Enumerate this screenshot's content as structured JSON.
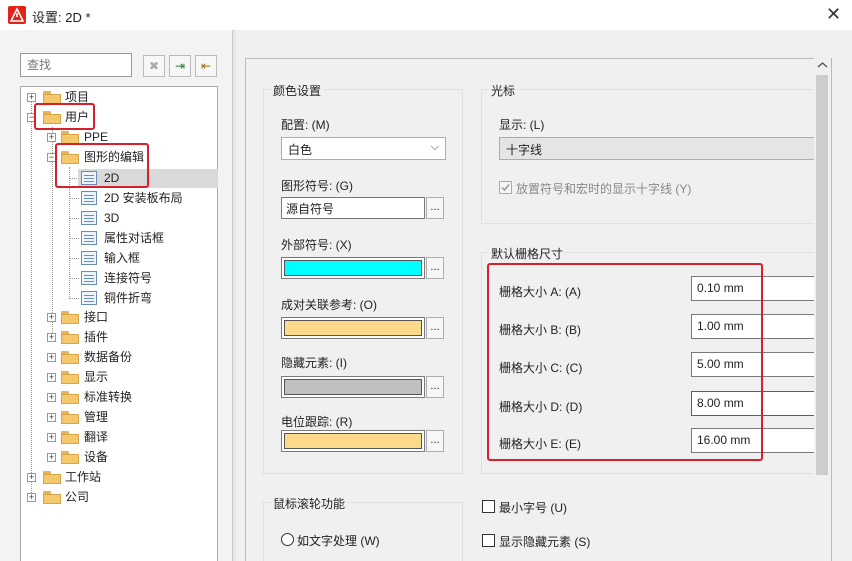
{
  "window": {
    "title": "设置: 2D *",
    "close_glyph": "✕"
  },
  "search": {
    "placeholder": "查找"
  },
  "tree_buttons": {
    "clear": "✖",
    "expand": "⇥",
    "collapse": "⇤"
  },
  "tree": {
    "items": [
      {
        "label": "项目",
        "kind": "folder",
        "expander": "+"
      },
      {
        "label": "用户",
        "kind": "folder",
        "expander": "−"
      },
      {
        "label": "PPE",
        "kind": "folder",
        "expander": "+"
      },
      {
        "label": "图形的编辑",
        "kind": "folder",
        "expander": "−"
      },
      {
        "label": "2D",
        "kind": "doc",
        "selected": true
      },
      {
        "label": "2D 安装板布局",
        "kind": "doc"
      },
      {
        "label": "3D",
        "kind": "doc"
      },
      {
        "label": "属性对话框",
        "kind": "doc"
      },
      {
        "label": "输入框",
        "kind": "doc"
      },
      {
        "label": "连接符号",
        "kind": "doc"
      },
      {
        "label": "铜件折弯",
        "kind": "doc"
      },
      {
        "label": "接口",
        "kind": "folder",
        "expander": "+"
      },
      {
        "label": "插件",
        "kind": "folder",
        "expander": "+"
      },
      {
        "label": "数据备份",
        "kind": "folder",
        "expander": "+"
      },
      {
        "label": "显示",
        "kind": "folder",
        "expander": "+"
      },
      {
        "label": "标准转换",
        "kind": "folder",
        "expander": "+"
      },
      {
        "label": "管理",
        "kind": "folder",
        "expander": "+"
      },
      {
        "label": "翻译",
        "kind": "folder",
        "expander": "+"
      },
      {
        "label": "设备",
        "kind": "folder",
        "expander": "+"
      },
      {
        "label": "工作站",
        "kind": "folder",
        "expander": "+"
      },
      {
        "label": "公司",
        "kind": "folder",
        "expander": "+"
      }
    ]
  },
  "color_settings": {
    "group_title": "颜色设置",
    "config_label": "配置: (M)",
    "config_value": "白色",
    "graphic_symbol_label": "图形符号: (G)",
    "graphic_symbol_value": "源自符号",
    "external_symbol_label": "外部符号: (X)",
    "pair_ref_label": "成对关联参考: (O)",
    "hidden_elements_label": "隐藏元素: (I)",
    "potential_trace_label": "电位跟踪: (R)",
    "ellipsis": "...",
    "colors": {
      "external": "#00ffff",
      "pair_ref": "#ffd98a",
      "hidden": "#c0c0c0",
      "potential": "#ffd98a"
    }
  },
  "cursor": {
    "group_title": "光标",
    "display_label": "显示: (L)",
    "display_value": "十字线",
    "crosshair_label": "放置符号和宏时的显示十字线 (Y)"
  },
  "grid": {
    "group_title": "默认栅格尺寸",
    "rows": [
      {
        "label": "栅格大小 A: (A)",
        "value": "0.10 mm"
      },
      {
        "label": "栅格大小 B: (B)",
        "value": "1.00 mm"
      },
      {
        "label": "栅格大小 C: (C)",
        "value": "5.00 mm"
      },
      {
        "label": "栅格大小 D: (D)",
        "value": "8.00 mm"
      },
      {
        "label": "栅格大小 E: (E)",
        "value": "16.00 mm"
      }
    ]
  },
  "mouse_wheel": {
    "group_title": "鼠标滚轮功能",
    "option1": "如文字处理 (W)"
  },
  "options": {
    "min_font": "最小字号 (U)",
    "show_hidden": "显示隐藏元素 (S)"
  },
  "accent_red": "#d8202a"
}
